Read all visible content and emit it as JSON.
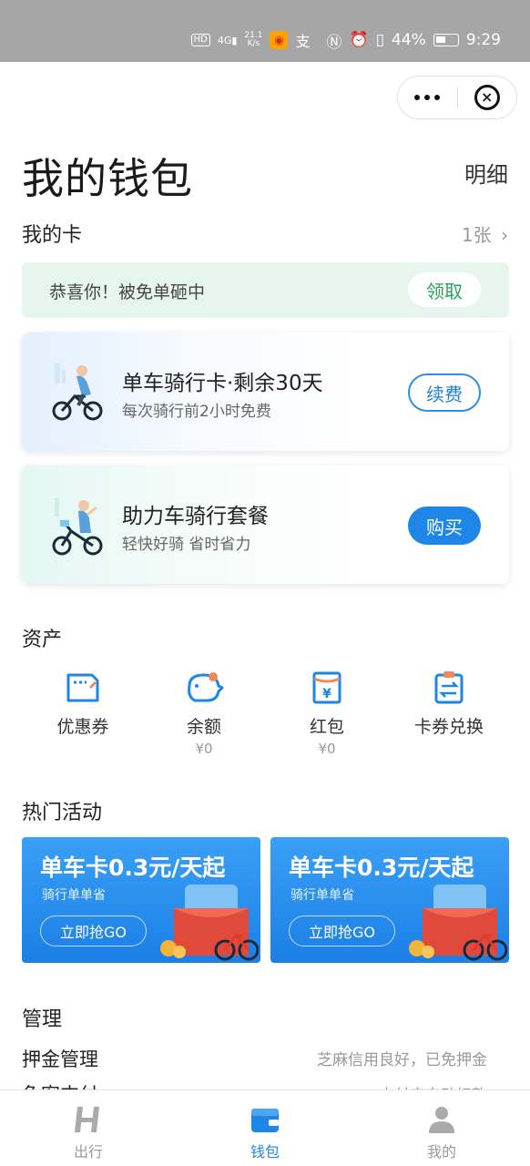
{
  "status_bar": {
    "net_type": "4G",
    "net_speed": "21.1",
    "net_unit": "K/s",
    "battery": "44%",
    "time": "9:29"
  },
  "page": {
    "title": "我的钱包",
    "detail_link": "明细"
  },
  "my_cards": {
    "label": "我的卡",
    "count": "1张",
    "banner_text": "恭喜你！被免单砸中",
    "banner_button": "领取",
    "cards": [
      {
        "title": "单车骑行卡·剩余30天",
        "subtitle": "每次骑行前2小时免费",
        "button": "续费"
      },
      {
        "title": "助力车骑行套餐",
        "subtitle": "轻快好骑 省时省力",
        "button": "购买"
      }
    ]
  },
  "assets": {
    "label": "资产",
    "items": [
      {
        "label": "优惠券",
        "value": "",
        "icon": "coupon-icon"
      },
      {
        "label": "余额",
        "value": "¥0",
        "icon": "piggy-bank-icon"
      },
      {
        "label": "红包",
        "value": "¥0",
        "icon": "red-packet-icon"
      },
      {
        "label": "卡券兑换",
        "value": "",
        "icon": "exchange-icon"
      }
    ]
  },
  "hot_activities": {
    "label": "热门活动",
    "promos": [
      {
        "title": "单车卡0.3元/天起",
        "subtitle": "骑行单单省",
        "button": "立即抢GO"
      },
      {
        "title": "单车卡0.3元/天起",
        "subtitle": "骑行单单省",
        "button": "立即抢GO"
      }
    ]
  },
  "management": {
    "label": "管理",
    "rows": [
      {
        "label": "押金管理",
        "value": "芝麻信用良好，已免押金"
      },
      {
        "label": "免密支付",
        "value": "支付宝自动扣款"
      }
    ]
  },
  "tabbar": {
    "tabs": [
      {
        "label": "出行",
        "icon": "hellobike-logo-icon"
      },
      {
        "label": "钱包",
        "icon": "wallet-icon"
      },
      {
        "label": "我的",
        "icon": "person-icon"
      }
    ]
  },
  "colors": {
    "accent": "#1d86e6",
    "banner_green": "#27a35a",
    "status_bar": "#a6a6a6"
  }
}
